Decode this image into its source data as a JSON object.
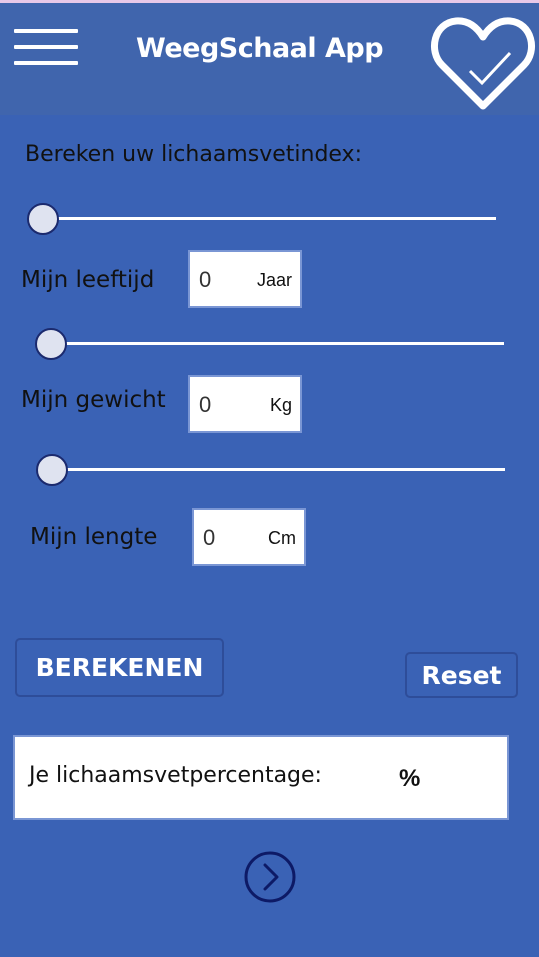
{
  "header": {
    "title": "WeegSchaal App",
    "menu_icon": "hamburger-menu-icon",
    "heart_icon": "heart-check-icon"
  },
  "form": {
    "heading": "Bereken uw lichaamsvetindex:",
    "age": {
      "label": "Mijn leeftijd",
      "value": "0",
      "unit": "Jaar",
      "slider_value": 0
    },
    "weight": {
      "label": "Mijn gewicht",
      "value": "0",
      "unit": "Kg",
      "slider_value": 0
    },
    "length": {
      "label": "Mijn lengte",
      "value": "0",
      "unit": "Cm",
      "slider_value": 0
    }
  },
  "buttons": {
    "calculate": "BEREKENEN",
    "reset": "Reset"
  },
  "result": {
    "label": "Je lichaamsvetpercentage:",
    "unit": "%"
  },
  "navigation": {
    "next_icon": "chevron-right-circle-icon"
  },
  "colors": {
    "background": "#3a62b5",
    "header": "#4065ad",
    "slider_thumb": "#dfe3f0",
    "accent_dark": "#1b2a6e"
  }
}
